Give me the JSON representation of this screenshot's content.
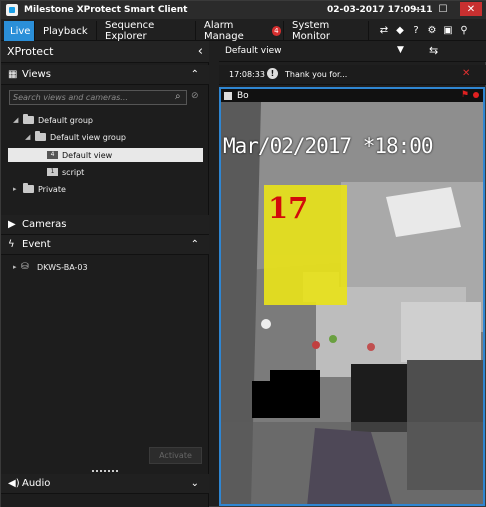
{
  "window": {
    "title": "Milestone XProtect Smart Client",
    "datetime": "02-03-2017 17:09:11",
    "minimize": "—",
    "maximize": "☐",
    "close": "✕"
  },
  "tabs": [
    {
      "label": "Live",
      "active": true
    },
    {
      "label": "Playback"
    },
    {
      "label": "Sequence Explorer"
    },
    {
      "label": "Alarm Manager",
      "display": "Alarm Manage",
      "badge": "4"
    },
    {
      "label": "System Monitor"
    }
  ],
  "left": {
    "brand": "XProtect",
    "collapse": "‹",
    "views": {
      "label": "Views",
      "search_placeholder": "Search views and cameras...",
      "tree": [
        {
          "label": "Default group"
        },
        {
          "label": "Default view group"
        },
        {
          "label": "Default view",
          "icon_text": "4",
          "selected": true
        },
        {
          "label": "script",
          "icon_text": "1"
        },
        {
          "label": "Private"
        }
      ]
    },
    "cameras": {
      "label": "Cameras"
    },
    "event": {
      "label": "Event",
      "tree": [
        {
          "label": "DKWS-BA-03"
        }
      ]
    },
    "activate_label": "Activate",
    "audio": {
      "label": "Audio"
    }
  },
  "view": {
    "name": "Default view",
    "message": {
      "time": "17:08:33",
      "text": "Thank you for..."
    },
    "tile": {
      "camera_name": "Bo",
      "osd_timestamp": "Mar/02/2017 *18:00",
      "overlay_number": "17"
    }
  },
  "colors": {
    "accent": "#2b8fd8",
    "tile_border": "#2f86d2",
    "alert": "#e02020",
    "overlay": "#e8e21a"
  }
}
